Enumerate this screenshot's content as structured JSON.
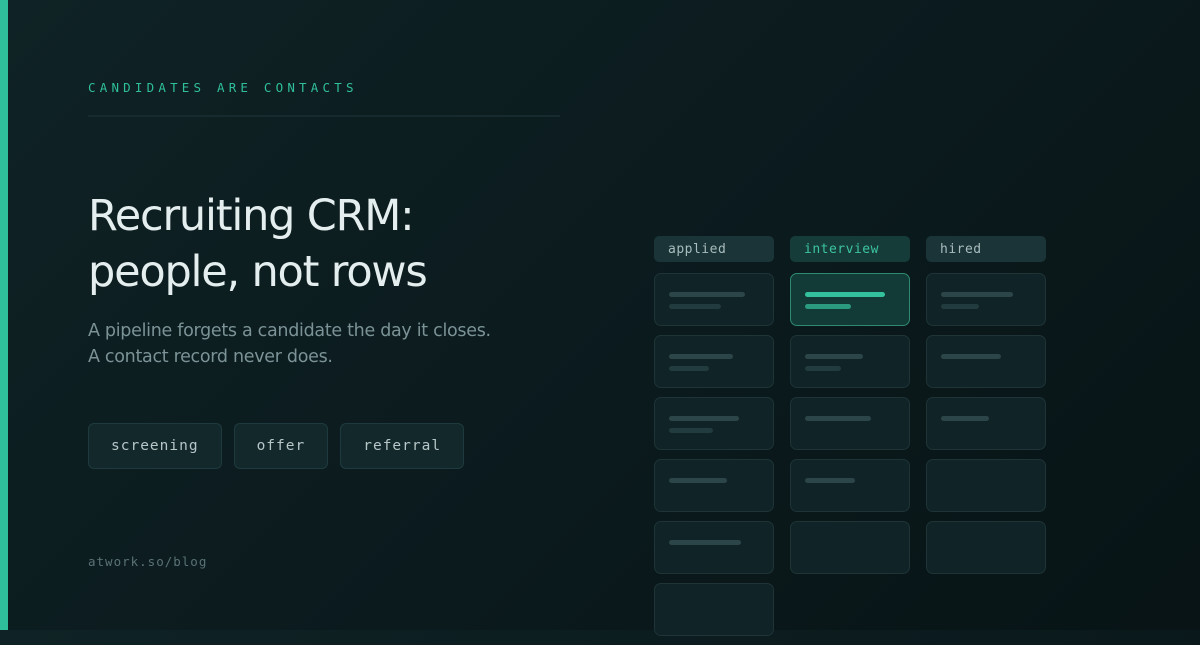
{
  "eyebrow": "CANDIDATES ARE CONTACTS",
  "headline": [
    "Recruiting CRM:",
    "people, not rows"
  ],
  "subtitle": [
    "A pipeline forgets a candidate the day it closes.",
    "A contact record never does."
  ],
  "tags": [
    "screening",
    "offer",
    "referral"
  ],
  "footer_url": "atwork.so/blog",
  "colors": {
    "accent": "#2fbf9a",
    "background": "#0b1a1d",
    "headline": "#e4eeee",
    "muted_text": "#7b9396"
  },
  "pipeline": {
    "columns": [
      {
        "label": "applied",
        "active": false,
        "card_count": 6
      },
      {
        "label": "interview",
        "active": true,
        "card_count": 5
      },
      {
        "label": "hired",
        "active": false,
        "card_count": 5
      }
    ]
  }
}
